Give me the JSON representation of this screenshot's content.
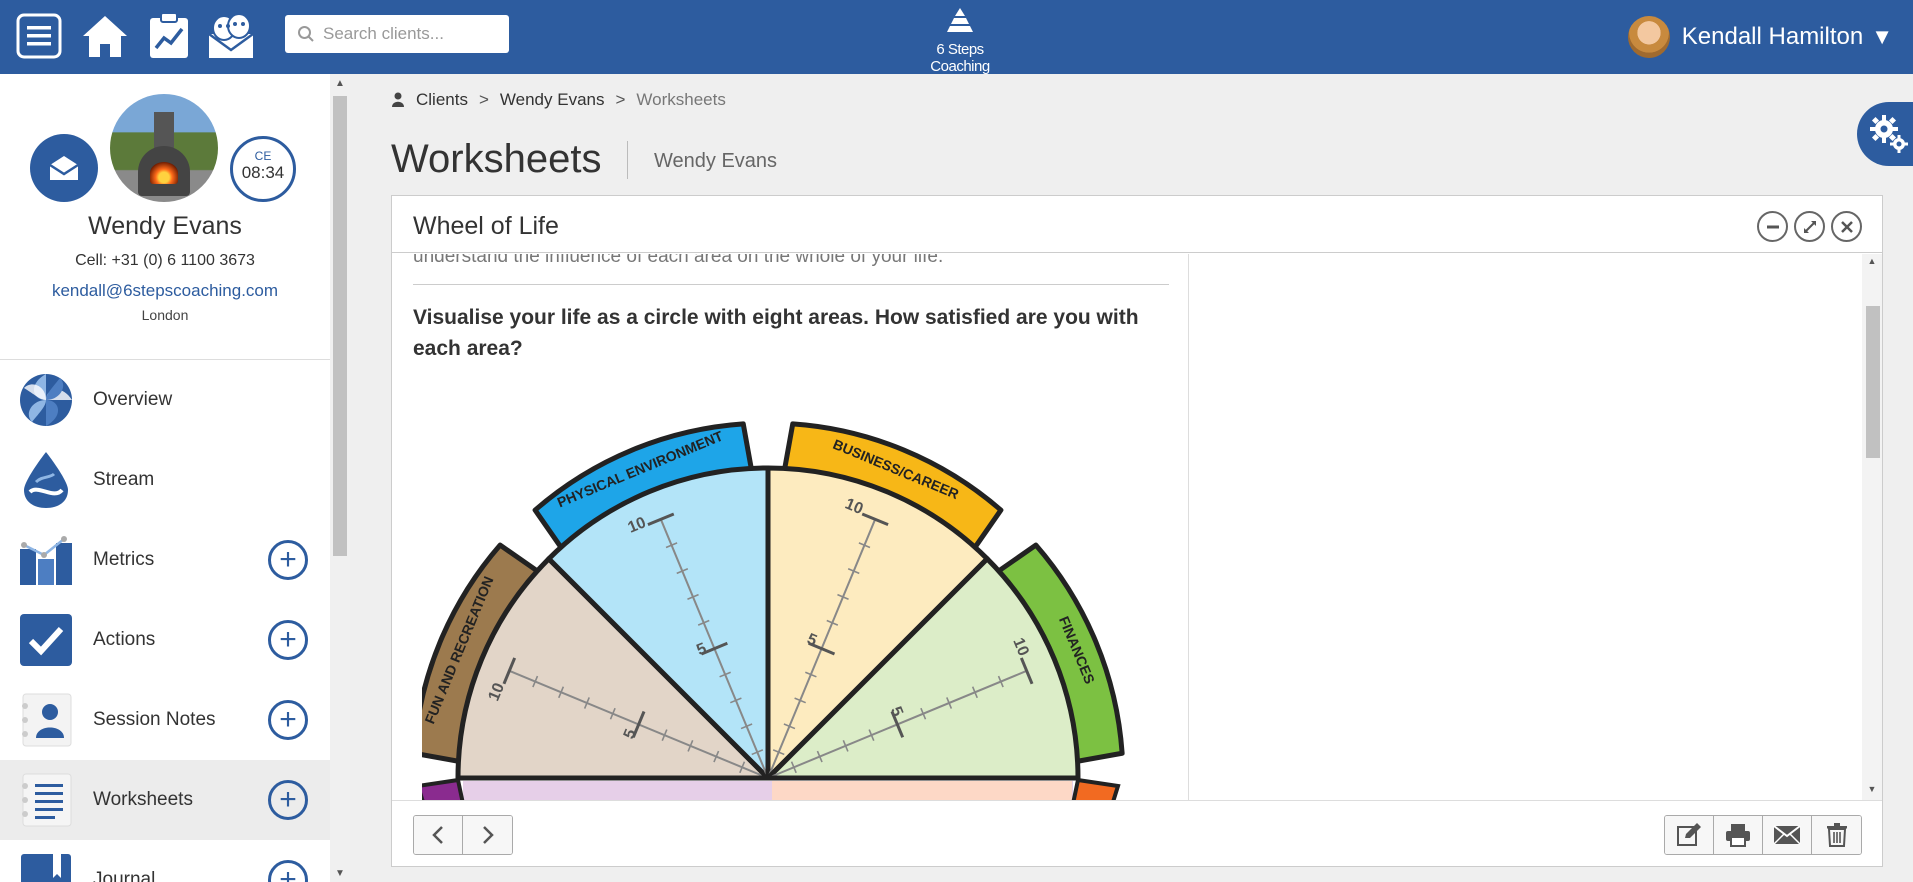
{
  "topbar": {
    "search_placeholder": "Search clients...",
    "logo_text": "6 Steps Coaching",
    "user_name": "Kendall Hamilton"
  },
  "profile": {
    "name": "Wendy Evans",
    "cell": "Cell:  +31 (0) 6 1100 3673",
    "email": "kendall@6stepscoaching.com",
    "city": "London",
    "ce_label": "CE",
    "ce_time": "08:34"
  },
  "nav": {
    "overview": "Overview",
    "stream": "Stream",
    "metrics": "Metrics",
    "actions": "Actions",
    "session_notes": "Session Notes",
    "worksheets": "Worksheets",
    "journal": "Journal"
  },
  "breadcrumb": {
    "clients": "Clients",
    "client": "Wendy Evans",
    "current": "Worksheets",
    "sep": ">"
  },
  "page": {
    "title": "Worksheets",
    "subtitle": "Wendy Evans"
  },
  "panel": {
    "title": "Wheel of Life",
    "intro": "understand the influence of each area on the whole of your life.",
    "question": "Visualise your life as a circle with eight areas. How satisfied are you with each area?"
  },
  "wheel": {
    "segments": [
      {
        "label": "FUN AND RECREATION",
        "tab_color": "#9c7a4e",
        "fill": "#e2d5c8"
      },
      {
        "label": "PHYSICAL ENVIRONMENT",
        "tab_color": "#1ea5e8",
        "fill": "#b3e4f8"
      },
      {
        "label": "BUSINESS/CAREER",
        "tab_color": "#f7b717",
        "fill": "#fdebbf"
      },
      {
        "label": "FINANCES",
        "tab_color": "#7cc142",
        "fill": "#dcedc8"
      }
    ],
    "scale_max": "10",
    "scale_mid": "5"
  },
  "colors": {
    "brand": "#2d5c9f"
  }
}
